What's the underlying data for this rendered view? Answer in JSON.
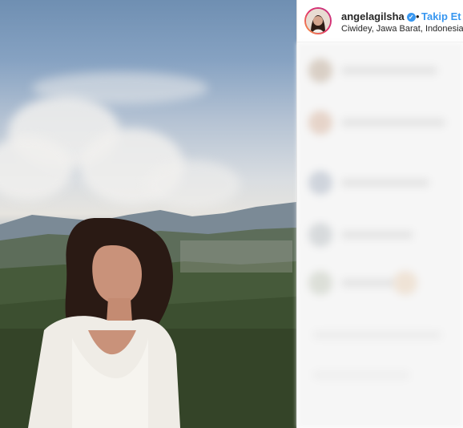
{
  "post": {
    "username": "angelagilsha",
    "verified": true,
    "separator": "•",
    "follow_label": "Takip Et",
    "location": "Ciwidey, Jawa Barat, Indonesia"
  },
  "colors": {
    "link": "#3897f0",
    "text": "#262626",
    "divider": "#dbdbdb"
  },
  "icons": {
    "verified": "verified-badge-icon",
    "avatar": "profile-avatar"
  }
}
